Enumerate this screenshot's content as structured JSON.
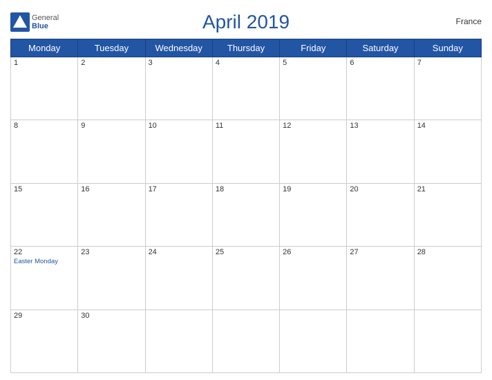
{
  "header": {
    "title": "April 2019",
    "country": "France",
    "logo": {
      "general": "General",
      "blue": "Blue"
    }
  },
  "weekdays": [
    "Monday",
    "Tuesday",
    "Wednesday",
    "Thursday",
    "Friday",
    "Saturday",
    "Sunday"
  ],
  "weeks": [
    [
      {
        "day": "1",
        "holiday": ""
      },
      {
        "day": "2",
        "holiday": ""
      },
      {
        "day": "3",
        "holiday": ""
      },
      {
        "day": "4",
        "holiday": ""
      },
      {
        "day": "5",
        "holiday": ""
      },
      {
        "day": "6",
        "holiday": ""
      },
      {
        "day": "7",
        "holiday": ""
      }
    ],
    [
      {
        "day": "8",
        "holiday": ""
      },
      {
        "day": "9",
        "holiday": ""
      },
      {
        "day": "10",
        "holiday": ""
      },
      {
        "day": "11",
        "holiday": ""
      },
      {
        "day": "12",
        "holiday": ""
      },
      {
        "day": "13",
        "holiday": ""
      },
      {
        "day": "14",
        "holiday": ""
      }
    ],
    [
      {
        "day": "15",
        "holiday": ""
      },
      {
        "day": "16",
        "holiday": ""
      },
      {
        "day": "17",
        "holiday": ""
      },
      {
        "day": "18",
        "holiday": ""
      },
      {
        "day": "19",
        "holiday": ""
      },
      {
        "day": "20",
        "holiday": ""
      },
      {
        "day": "21",
        "holiday": ""
      }
    ],
    [
      {
        "day": "22",
        "holiday": "Easter Monday"
      },
      {
        "day": "23",
        "holiday": ""
      },
      {
        "day": "24",
        "holiday": ""
      },
      {
        "day": "25",
        "holiday": ""
      },
      {
        "day": "26",
        "holiday": ""
      },
      {
        "day": "27",
        "holiday": ""
      },
      {
        "day": "28",
        "holiday": ""
      }
    ],
    [
      {
        "day": "29",
        "holiday": ""
      },
      {
        "day": "30",
        "holiday": ""
      },
      {
        "day": "",
        "holiday": ""
      },
      {
        "day": "",
        "holiday": ""
      },
      {
        "day": "",
        "holiday": ""
      },
      {
        "day": "",
        "holiday": ""
      },
      {
        "day": "",
        "holiday": ""
      }
    ]
  ]
}
